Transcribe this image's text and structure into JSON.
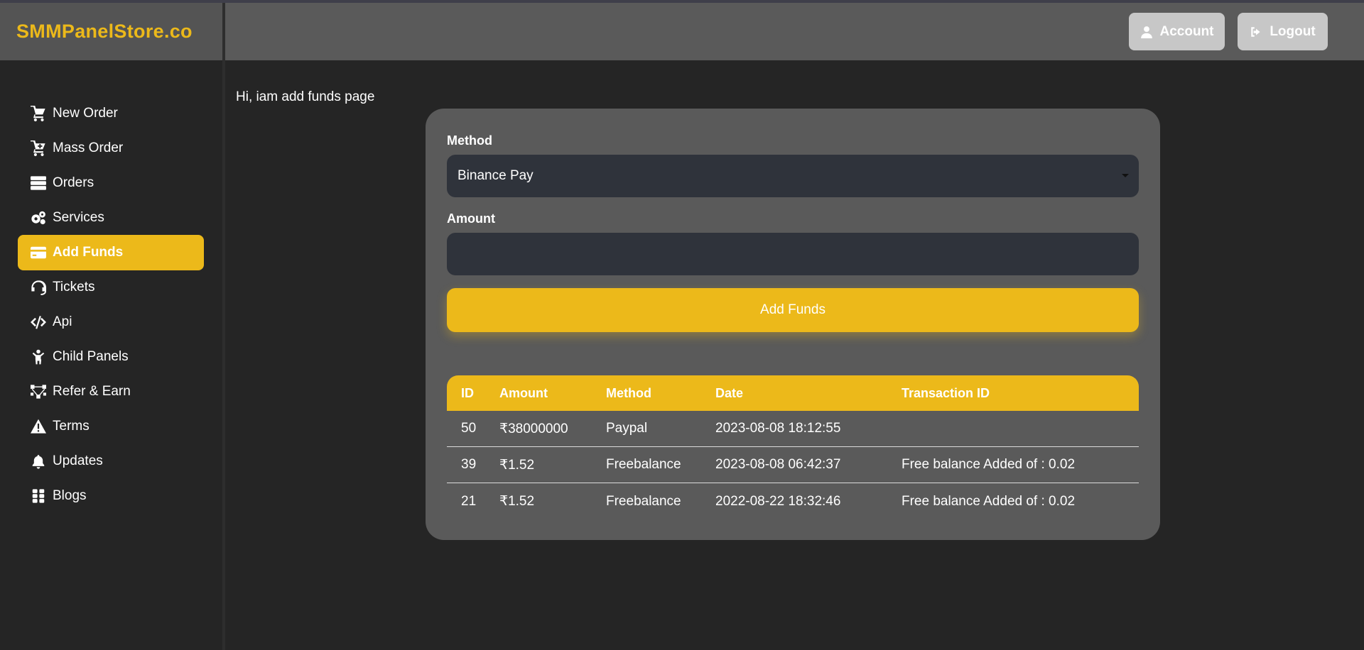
{
  "brand": "SMMPanelStore.co",
  "header": {
    "account_label": "Account",
    "logout_label": "Logout"
  },
  "sidebar": {
    "items": [
      {
        "label": "New Order",
        "icon": "cart-icon"
      },
      {
        "label": "Mass Order",
        "icon": "cart-plus-icon"
      },
      {
        "label": "Orders",
        "icon": "server-icon"
      },
      {
        "label": "Services",
        "icon": "gears-icon"
      },
      {
        "label": "Add Funds",
        "icon": "credit-card-icon",
        "active": true
      },
      {
        "label": "Tickets",
        "icon": "headset-icon"
      },
      {
        "label": "Api",
        "icon": "code-icon"
      },
      {
        "label": "Child Panels",
        "icon": "child-icon"
      },
      {
        "label": "Refer & Earn",
        "icon": "network-icon"
      },
      {
        "label": "Terms",
        "icon": "warning-icon"
      },
      {
        "label": "Updates",
        "icon": "bell-icon"
      },
      {
        "label": "Blogs",
        "icon": "grid-icon"
      }
    ]
  },
  "main": {
    "greeting": "Hi, iam add funds page",
    "form": {
      "method_label": "Method",
      "method_value": "Binance Pay",
      "amount_label": "Amount",
      "amount_value": "",
      "submit_label": "Add Funds"
    },
    "table": {
      "headers": [
        "ID",
        "Amount",
        "Method",
        "Date",
        "Transaction ID"
      ],
      "rows": [
        [
          "50",
          "₹38000000",
          "Paypal",
          "2023-08-08 18:12:55",
          ""
        ],
        [
          "39",
          "₹1.52",
          "Freebalance",
          "2023-08-08 06:42:37",
          "Free balance Added of : 0.02"
        ],
        [
          "21",
          "₹1.52",
          "Freebalance",
          "2022-08-22 18:32:46",
          "Free balance Added of : 0.02"
        ]
      ]
    }
  },
  "colors": {
    "accent": "#ecb91a",
    "background": "#252525",
    "card": "#5a5a5a",
    "input": "#2f333b"
  }
}
